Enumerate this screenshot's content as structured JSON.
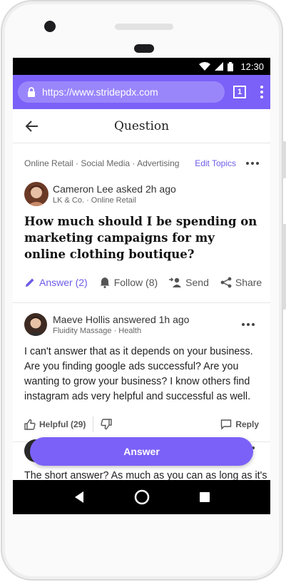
{
  "status": {
    "time": "12:30"
  },
  "browser": {
    "url": "https://www.stridepdx.com",
    "tab_count": "1"
  },
  "header": {
    "title": "Question"
  },
  "question": {
    "topics": "Online Retail · Social Media · Advertising",
    "edit_topics": "Edit Topics",
    "author": "Cameron Lee asked 2h ago",
    "author_sub": "LK & Co. · Online Retail",
    "title": "How much should I be spending on marketing campaigns for my online clothing boutique?",
    "actions": {
      "answer": "Answer (2)",
      "follow": "Follow (8)",
      "send": "Send",
      "share": "Share"
    }
  },
  "answer": {
    "author": "Maeve Hollis answered 1h ago",
    "author_sub": "Fluidity Massage · Health",
    "body": "I can't answer that as it depends on your business. Are you finding google ads successful? Are you wanting to grow your business? I know others find instagram ads very helpful and successful as well.",
    "helpful": "Helpful (29)",
    "reply": "Reply"
  },
  "next_answer": {
    "body": "The short answer? As much as you can as long as it's"
  },
  "answer_button": "Answer",
  "colors": {
    "accent": "#7b61f8",
    "link": "#6c5ce7"
  }
}
